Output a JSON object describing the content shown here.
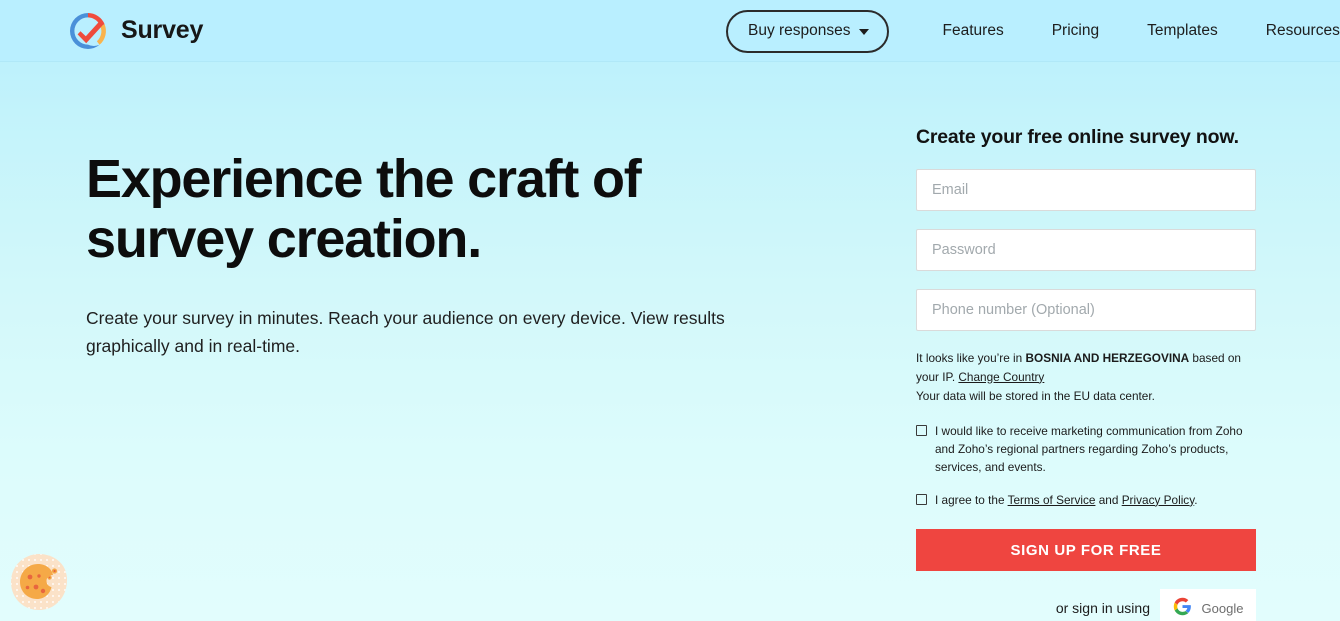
{
  "header": {
    "brand": {
      "name": "Survey",
      "logo_icon": "zoho-survey-logo-icon"
    },
    "buy_responses": {
      "label": "Buy responses",
      "caret_icon": "chevron-down-icon"
    },
    "nav_links": [
      {
        "label": "Features"
      },
      {
        "label": "Pricing"
      },
      {
        "label": "Templates"
      },
      {
        "label": "Resources"
      }
    ]
  },
  "hero": {
    "title": "Experience the craft of survey creation.",
    "subtitle": "Create your survey in minutes. Reach your audience on every device. View results graphically and in real-time."
  },
  "signup": {
    "title": "Create your free online survey now.",
    "email": {
      "value": "",
      "placeholder": "Email"
    },
    "password": {
      "value": "",
      "placeholder": "Password"
    },
    "phone": {
      "value": "",
      "placeholder": "Phone number (Optional)"
    },
    "geo": {
      "prefix": "It looks like you’re in ",
      "country": "BOSNIA AND HERZEGOVINA",
      "suffix": " based on your IP. ",
      "change_country_link": "Change Country",
      "data_center_note": "Your data will be stored in the EU data center."
    },
    "marketing_consent": {
      "text": "I would like to receive marketing communication from Zoho and Zoho’s regional partners regarding Zoho’s products, services, and events.",
      "checked": false
    },
    "terms_consent": {
      "prefix": "I agree to the ",
      "terms_link": "Terms of Service",
      "middle": " and ",
      "privacy_link": "Privacy Policy",
      "suffix": ".",
      "checked": false
    },
    "submit_label": "SIGN UP FOR FREE",
    "social": {
      "label": "or sign in using",
      "google_label": "Google",
      "google_icon": "google-g-icon"
    }
  },
  "cookie_widget": {
    "icon": "cookie-icon"
  },
  "colors": {
    "accent_red": "#ef4540",
    "bg_top": "#b6eefd",
    "bg_bottom": "#e2fdfd",
    "logo_red": "#f04c3e",
    "logo_blue": "#4a90d9",
    "logo_orange": "#f9b44d"
  }
}
